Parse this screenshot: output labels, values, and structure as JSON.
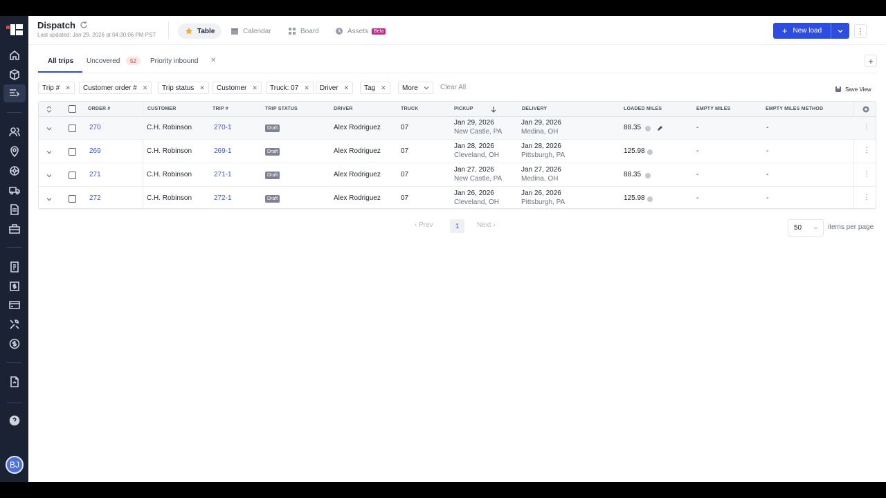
{
  "header": {
    "title": "Dispatch",
    "last_updated": "Last updated: Jan 29, 2026 at 04:30:06 PM PST",
    "views": [
      {
        "label": "Table"
      },
      {
        "label": "Calendar"
      },
      {
        "label": "Board"
      },
      {
        "label": "Assets",
        "badge": "Beta"
      }
    ],
    "new_load_label": "New load"
  },
  "sidebar": {
    "icons": [
      "home-icon",
      "box-icon",
      "dispatch-icon",
      "users-icon",
      "location-icon",
      "wheel-icon",
      "truck-icon",
      "document-icon",
      "briefcase-icon",
      "report-icon",
      "billing-icon",
      "card-icon",
      "tools-icon",
      "dollar-icon",
      "file-icon",
      "help-icon"
    ],
    "avatar_initials": "BJ"
  },
  "trip_tabs": [
    {
      "label": "All trips"
    },
    {
      "label": "Uncovered",
      "count": "52"
    },
    {
      "label": "Priority inbound"
    }
  ],
  "filters": [
    "Trip #",
    "Customer order #",
    "Trip status",
    "Customer",
    "Truck: 07",
    "Driver",
    "Tag"
  ],
  "more_label": "More",
  "clear_all_label": "Clear All",
  "save_view_label": "Save View",
  "table": {
    "columns": [
      "ORDER #",
      "CUSTOMER",
      "TRIP #",
      "TRIP STATUS",
      "DRIVER",
      "TRUCK",
      "PICKUP",
      "DELIVERY",
      "LOADED MILES",
      "EMPTY MILES",
      "EMPTY MILES METHOD"
    ],
    "rows": [
      {
        "order": "270",
        "customer": "C.H. Robinson",
        "trip": "270-1",
        "status": "Draft",
        "driver": "Alex Rodriguez",
        "truck": "07",
        "pickup_date": "Jan 29, 2026",
        "pickup_place": "New Castle, PA",
        "delivery_date": "Jan 29, 2026",
        "delivery_place": "Medina, OH",
        "loaded": "88.35",
        "empty": "-",
        "method": "-"
      },
      {
        "order": "269",
        "customer": "C.H. Robinson",
        "trip": "269-1",
        "status": "Draft",
        "driver": "Alex Rodriguez",
        "truck": "07",
        "pickup_date": "Jan 28, 2026",
        "pickup_place": "Cleveland, OH",
        "delivery_date": "Jan 28, 2026",
        "delivery_place": "Pittsburgh, PA",
        "loaded": "125.98",
        "empty": "-",
        "method": "-"
      },
      {
        "order": "271",
        "customer": "C.H. Robinson",
        "trip": "271-1",
        "status": "Draft",
        "driver": "Alex Rodriguez",
        "truck": "07",
        "pickup_date": "Jan 27, 2026",
        "pickup_place": "New Castle, PA",
        "delivery_date": "Jan 27, 2026",
        "delivery_place": "Medina, OH",
        "loaded": "88.35",
        "empty": "-",
        "method": "-"
      },
      {
        "order": "272",
        "customer": "C.H. Robinson",
        "trip": "272-1",
        "status": "Draft",
        "driver": "Alex Rodriguez",
        "truck": "07",
        "pickup_date": "Jan 26, 2026",
        "pickup_place": "Cleveland, OH",
        "delivery_date": "Jan 26, 2026",
        "delivery_place": "Pittsburgh, PA",
        "loaded": "125.98",
        "empty": "-",
        "method": "-"
      }
    ]
  },
  "pagination": {
    "prev": "Prev",
    "page": "1",
    "next": "Next",
    "per_page": "50",
    "per_page_label": "items per page"
  },
  "colors": {
    "accent": "#2d4de0",
    "sidebar": "#1a2233",
    "badge_pink": "#c8278a"
  }
}
